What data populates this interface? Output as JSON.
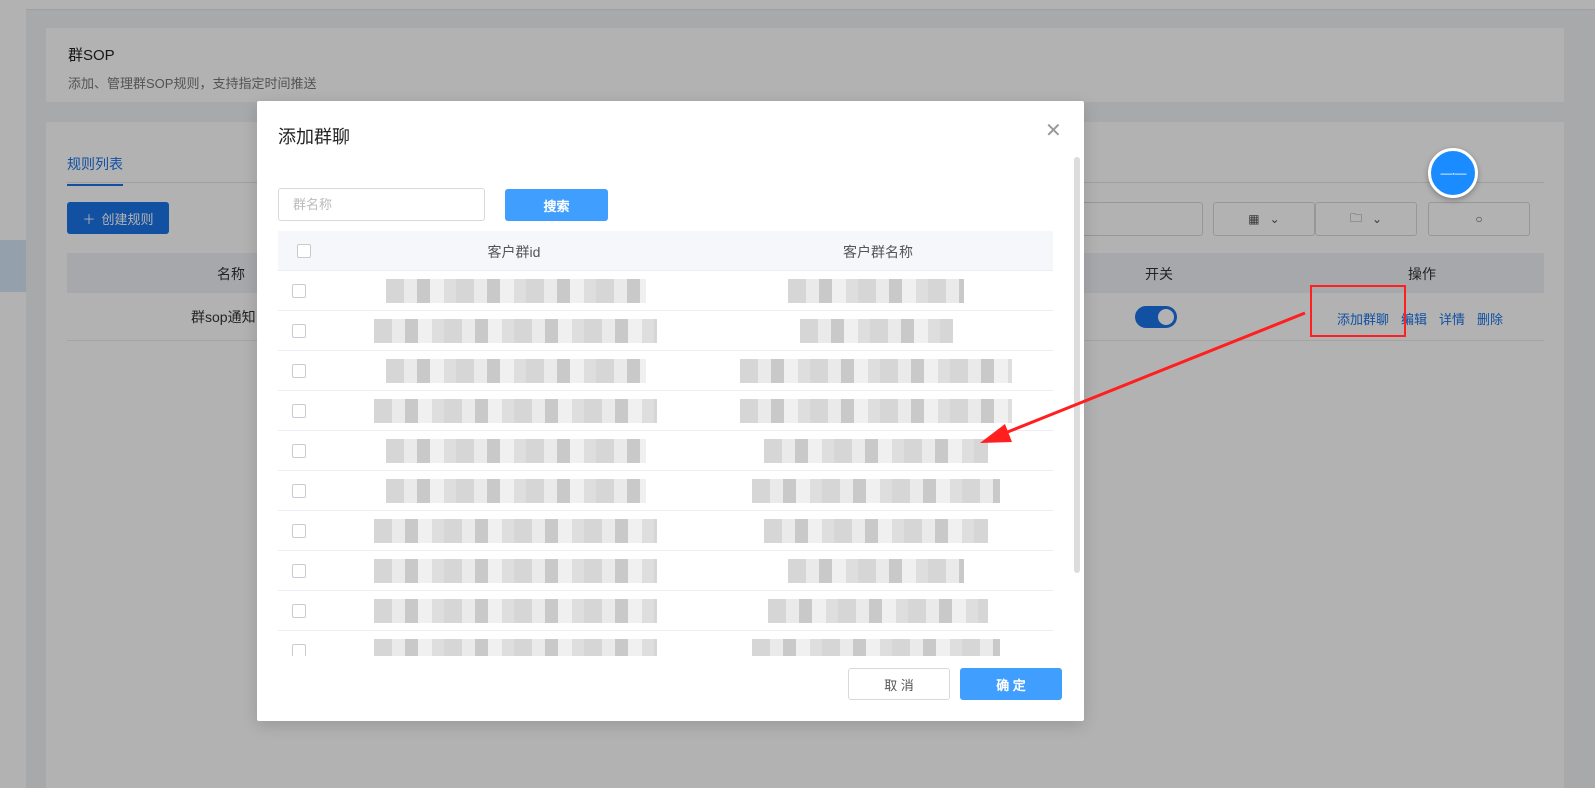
{
  "page": {
    "title": "群SOP",
    "subtitle": "添加、管理群SOP规则，支持指定时间推送"
  },
  "rules": {
    "tab_label": "规则列表",
    "create_button": "创建规则",
    "columns": {
      "name": "名称",
      "switch": "开关",
      "actions": "操作"
    },
    "rows": [
      {
        "name": "群sop通知",
        "switch_on": true,
        "actions": [
          "添加群聊",
          "编辑",
          "详情",
          "删除"
        ]
      }
    ]
  },
  "modal": {
    "title": "添加群聊",
    "search_placeholder": "群名称",
    "search_button": "搜索",
    "columns": {
      "id": "客户群id",
      "name": "客户群名称"
    },
    "cancel_button": "取 消",
    "confirm_button": "确 定"
  },
  "colors": {
    "accent": "#409eff",
    "primary": "#1a73e8",
    "highlight": "#ff1f1f"
  }
}
